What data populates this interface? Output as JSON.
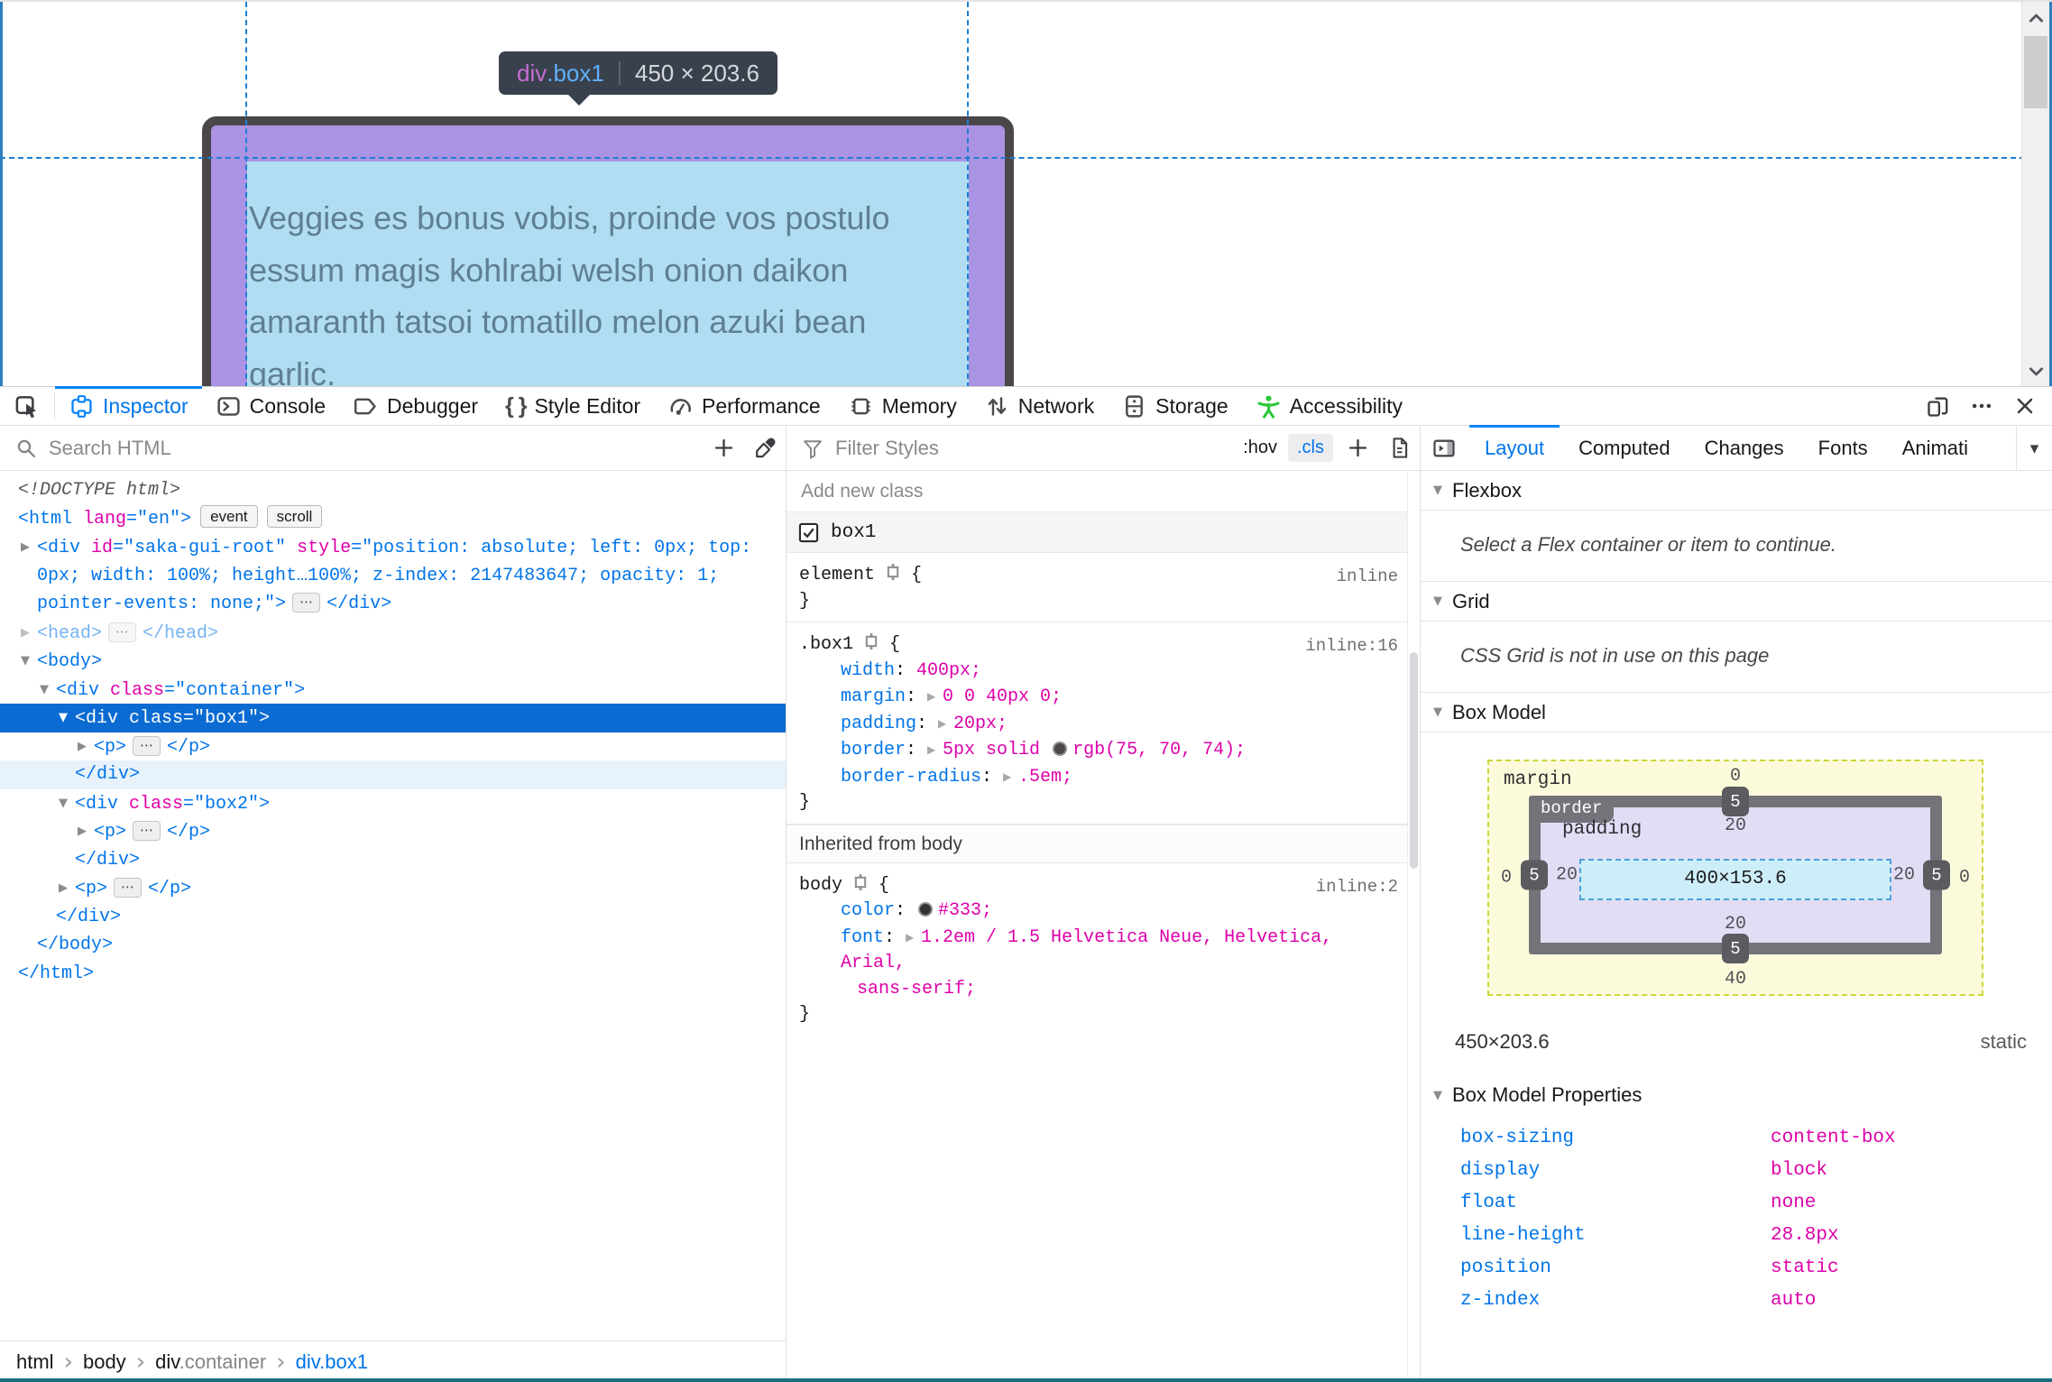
{
  "icons": {
    "twisty_open": "▼",
    "twisty_closed": "▶",
    "dots": "⋯",
    "crumb_sep": "›",
    "dropdown": "▾",
    "braces": "{ }"
  },
  "ui": {
    "brace_open": "{",
    "brace_close": "}"
  },
  "page": {
    "infobar": {
      "tag": "div",
      "cls": ".box1",
      "dims": "450 × 203.6"
    },
    "body_lines": [
      "Veggies es bonus vobis, proinde vos postulo",
      "essum magis kohlrabi welsh onion daikon",
      "amaranth tatsoi tomatillo melon azuki bean",
      "garlic."
    ]
  },
  "toolbar": {
    "tabs": [
      {
        "label": "Inspector",
        "active": true
      },
      {
        "label": "Console"
      },
      {
        "label": "Debugger"
      },
      {
        "label": "Style Editor"
      },
      {
        "label": "Performance"
      },
      {
        "label": "Memory"
      },
      {
        "label": "Network"
      },
      {
        "label": "Storage"
      },
      {
        "label": "Accessibility"
      }
    ],
    "accessibility_color": "#2bc939"
  },
  "markup": {
    "search_placeholder": "Search HTML",
    "rows": [
      {
        "ind": 0,
        "segs": [
          [
            "<!DOCTYPE html>",
            "d"
          ]
        ]
      },
      {
        "ind": 0,
        "segs": [
          [
            "<html",
            "t"
          ],
          [
            " lang",
            "a"
          ],
          [
            "=\"en\"",
            "v"
          ],
          [
            ">",
            "t"
          ],
          [
            "event",
            "badge"
          ],
          [
            "scroll",
            "badge"
          ]
        ]
      },
      {
        "ind": 1,
        "arrow": "closed",
        "segs": [
          [
            "<div",
            "t"
          ],
          [
            " id",
            "a"
          ],
          [
            "=\"saka-gui-root\"",
            "v"
          ],
          [
            " style",
            "a"
          ],
          [
            "=\"position: absolute; left: 0px; top:",
            "v"
          ]
        ]
      },
      {
        "ind": 1,
        "segs": [
          [
            "0px; width: 100%; height…100%; z-index: 2147483647; opacity: 1;",
            "v"
          ]
        ]
      },
      {
        "ind": 1,
        "segs": [
          [
            "pointer-events: none;\"",
            "v"
          ],
          [
            ">",
            "t"
          ],
          [
            "",
            "dots"
          ],
          [
            "</div>",
            "t"
          ]
        ]
      },
      {
        "ind": 1,
        "arrow": "closed",
        "dim": true,
        "segs": [
          [
            "<head>",
            "t"
          ],
          [
            "",
            "dots"
          ],
          [
            "</head>",
            "t"
          ]
        ]
      },
      {
        "ind": 1,
        "arrow": "open",
        "segs": [
          [
            "<body>",
            "t"
          ]
        ]
      },
      {
        "ind": 2,
        "arrow": "open",
        "segs": [
          [
            "<div",
            "t"
          ],
          [
            " class",
            "a"
          ],
          [
            "=\"container\"",
            "v"
          ],
          [
            ">",
            "t"
          ]
        ]
      },
      {
        "ind": 3,
        "arrow": "open",
        "sel": true,
        "segs": [
          [
            "<div",
            "t"
          ],
          [
            " class",
            "a"
          ],
          [
            "=\"box1\"",
            "v"
          ],
          [
            ">",
            "t"
          ]
        ]
      },
      {
        "ind": 4,
        "arrow": "closed",
        "segs": [
          [
            "<p>",
            "t"
          ],
          [
            "",
            "dots"
          ],
          [
            "</p>",
            "t"
          ]
        ]
      },
      {
        "ind": 3,
        "tint": true,
        "segs": [
          [
            "</div>",
            "t"
          ]
        ]
      },
      {
        "ind": 3,
        "arrow": "open",
        "segs": [
          [
            "<div",
            "t"
          ],
          [
            " class",
            "a"
          ],
          [
            "=\"box2\"",
            "v"
          ],
          [
            ">",
            "t"
          ]
        ]
      },
      {
        "ind": 4,
        "arrow": "closed",
        "segs": [
          [
            "<p>",
            "t"
          ],
          [
            "",
            "dots"
          ],
          [
            "</p>",
            "t"
          ]
        ]
      },
      {
        "ind": 3,
        "segs": [
          [
            "</div>",
            "t"
          ]
        ]
      },
      {
        "ind": 3,
        "arrow": "closed",
        "segs": [
          [
            "<p>",
            "t"
          ],
          [
            "",
            "dots"
          ],
          [
            "</p>",
            "t"
          ]
        ]
      },
      {
        "ind": 2,
        "segs": [
          [
            "</div>",
            "t"
          ]
        ]
      },
      {
        "ind": 1,
        "segs": [
          [
            "</body>",
            "t"
          ]
        ]
      },
      {
        "ind": 0,
        "segs": [
          [
            "</html>",
            "t"
          ]
        ]
      }
    ],
    "breadcrumbs": [
      {
        "segs": [
          [
            "html",
            "dark"
          ]
        ]
      },
      {
        "segs": [
          [
            "body",
            "dark"
          ]
        ]
      },
      {
        "segs": [
          [
            "div",
            "dark"
          ],
          [
            ".container",
            "gray"
          ]
        ]
      },
      {
        "segs": [
          [
            "div.box1",
            "blue"
          ]
        ]
      }
    ]
  },
  "rules": {
    "filter_placeholder": "Filter Styles",
    "hov_label": ":hov",
    "cls_label": ".cls",
    "add_class_placeholder": "Add new class",
    "classes": [
      {
        "name": "box1",
        "checked": true
      }
    ],
    "element_rule": {
      "selector": "element",
      "location": "inline"
    },
    "box1_rule": {
      "selector": ".box1",
      "location": "inline:16",
      "decls": [
        {
          "name": "width",
          "pre": "400px"
        },
        {
          "name": "margin",
          "expand": true,
          "pre": "0 0 40px 0"
        },
        {
          "name": "padding",
          "expand": true,
          "pre": "20px"
        },
        {
          "name": "border",
          "expand": true,
          "pre": "5px solid ",
          "swatch": "#4b464a",
          "post": "rgb(75, 70, 74)"
        },
        {
          "name": "border-radius",
          "expand": true,
          "pre": ".5em"
        }
      ]
    },
    "inherited_header": "Inherited from body",
    "body_rule": {
      "selector": "body",
      "location": "inline:2",
      "decls": [
        {
          "name": "color",
          "swatch": "#333333",
          "post": "#333"
        },
        {
          "name": "font",
          "expand": true,
          "pre": "1.2em / 1.5 Helvetica Neue, Helvetica, Arial,",
          "cont": "sans-serif;"
        }
      ]
    }
  },
  "layout": {
    "tabs": [
      {
        "label": "Layout",
        "active": true
      },
      {
        "label": "Computed"
      },
      {
        "label": "Changes"
      },
      {
        "label": "Fonts"
      },
      {
        "label": "Animati",
        "clipped": true
      }
    ],
    "flexbox": {
      "title": "Flexbox",
      "empty": "Select a Flex container or item to continue."
    },
    "grid": {
      "title": "Grid",
      "empty": "CSS Grid is not in use on this page"
    },
    "boxmodel": {
      "title": "Box Model",
      "labels": {
        "margin": "margin",
        "border": "border",
        "padding": "padding"
      },
      "content": "400×153.6",
      "margin": {
        "top": "0",
        "right": "0",
        "bottom": "40",
        "left": "0"
      },
      "border": {
        "top": "5",
        "right": "5",
        "bottom": "5",
        "left": "5"
      },
      "padding": {
        "top": "20",
        "right": "20",
        "bottom": "20",
        "left": "20"
      },
      "dims": "450×203.6",
      "position": "static",
      "props_title": "Box Model Properties",
      "props": [
        [
          "box-sizing",
          "content-box"
        ],
        [
          "display",
          "block"
        ],
        [
          "float",
          "none"
        ],
        [
          "line-height",
          "28.8px"
        ],
        [
          "position",
          "static"
        ],
        [
          "z-index",
          "auto"
        ]
      ]
    }
  }
}
